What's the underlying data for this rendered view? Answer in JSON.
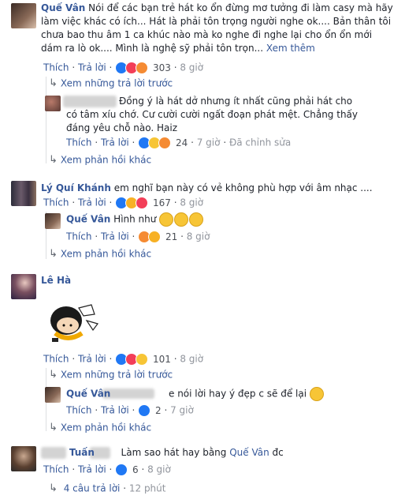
{
  "actions": {
    "like": "Thích",
    "reply": "Trả lời",
    "edit_history": "Đã chỉnh sửa",
    "dot": "·"
  },
  "comment1": {
    "author": "Quế Vân",
    "text": "Nói để các bạn trẻ hát ko ổn đừng mơ tưởng đi làm casy mà hãy làm việc khác có ích... Hát là phải tôn trọng người nghe ok.... Bản thân tôi chưa bao thu âm 1 ca khúc nào mà ko nghe đi nghe lại cho ổn ổn mới dám ra lò ok.... Mình là nghệ sỹ phải tôn trọn...",
    "see_more": "Xem thêm",
    "reactions_count": "303",
    "time": "8 giờ",
    "view_prev": "Xem những trả lời trước",
    "reply": {
      "text": "Đồng ý là hát dở nhưng ít nhất cũng phải hát cho có tâm xíu chớ. Cư cười cười ngất đoạn phát mệt. Chẳng thấy đáng yêu chỗ nào. Haiz",
      "reactions_count": "24",
      "time": "7 giờ"
    },
    "more_replies": "Xem phản hồi khác"
  },
  "comment2": {
    "author": "Lý Quí Khánh",
    "text": "em nghĩ bạn này có vẻ không phù hợp với âm nhạc ....",
    "reactions_count": "167",
    "time": "8 giờ",
    "reply": {
      "author": "Quế Vân",
      "text": "Hình như",
      "reactions_count": "21",
      "time": "8 giờ"
    },
    "more_replies": "Xem phản hồi khác"
  },
  "comment3": {
    "author": "Lê Hà",
    "reactions_count": "101",
    "time": "8 giờ",
    "view_prev": "Xem những trả lời trước",
    "reply": {
      "author": "Quế Vân",
      "text": "e nói lời hay ý đẹp c sẽ để lại",
      "reactions_count": "2",
      "time": "7 giờ"
    },
    "more_replies": "Xem phản hồi khác"
  },
  "comment4": {
    "author_partial": "Tuấn",
    "text": "Làm sao hát hay bằng",
    "mention": "Quế Vân",
    "text_end": "đc",
    "reactions_count": "6",
    "time": "8 giờ",
    "replies_summary": "4 câu trả lời",
    "replies_time": "12 phút"
  },
  "colors": {
    "link": "#365899",
    "muted": "#90949c",
    "like": "#2078f4",
    "love": "#f33e58",
    "haha": "#f7b125"
  }
}
